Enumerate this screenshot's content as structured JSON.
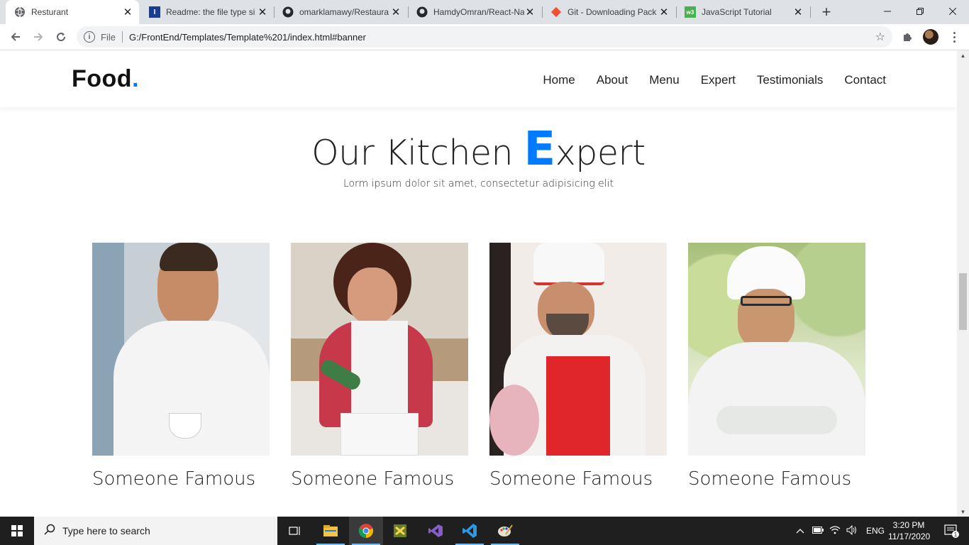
{
  "browser": {
    "tabs": [
      {
        "title": "Resturant",
        "favicon": "globe-icon",
        "active": true
      },
      {
        "title": "Readme: the file type si",
        "favicon": "readme-icon",
        "active": false
      },
      {
        "title": "omarklamawy/Restaura",
        "favicon": "github-icon",
        "active": false
      },
      {
        "title": "HamdyOmran/React-Na",
        "favicon": "github-icon",
        "active": false
      },
      {
        "title": "Git - Downloading Pack",
        "favicon": "git-icon",
        "active": false
      },
      {
        "title": "JavaScript Tutorial",
        "favicon": "w3schools-icon",
        "active": false
      }
    ],
    "new_tab_label": "+",
    "omnibox": {
      "scheme_label": "File",
      "url": "G:/FrontEnd/Templates/Template%201/index.html#banner"
    }
  },
  "site": {
    "brand": "Food",
    "brand_dot": ".",
    "brand_dot_color": "#007bff",
    "nav": [
      "Home",
      "About",
      "Menu",
      "Expert",
      "Testimonials",
      "Contact"
    ],
    "section": {
      "title_before": "Our Kitchen ",
      "title_accent": "E",
      "title_after": "xpert",
      "subtitle": "Lorm ipsum dolor sit amet, consectetur adipisicing elit"
    },
    "experts": [
      {
        "name": "Someone Famous",
        "photo": "chef-holding-cup-photo"
      },
      {
        "name": "Someone Famous",
        "photo": "baker-decorating-photo"
      },
      {
        "name": "Someone Famous",
        "photo": "chef-red-apron-photo"
      },
      {
        "name": "Someone Famous",
        "photo": "chef-arms-crossed-photo"
      }
    ]
  },
  "taskbar": {
    "search_placeholder": "Type here to search",
    "language": "ENG",
    "time": "3:20 PM",
    "date": "11/17/2020",
    "notification_count": "1"
  }
}
